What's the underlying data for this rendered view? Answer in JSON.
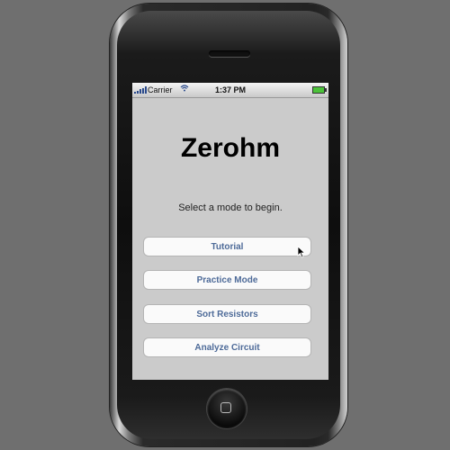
{
  "status_bar": {
    "carrier": "Carrier",
    "time": "1:37 PM",
    "wifi_icon": "wifi-icon",
    "battery_icon": "battery-icon"
  },
  "app": {
    "title": "Zerohm",
    "subtitle": "Select a mode to begin."
  },
  "modes": [
    {
      "label": "Tutorial"
    },
    {
      "label": "Practice Mode"
    },
    {
      "label": "Sort Resistors"
    },
    {
      "label": "Analyze Circuit"
    }
  ],
  "colors": {
    "button_text": "#4d6a98",
    "screen_bg": "#cbcbcb",
    "backdrop": "#6f6f6f"
  }
}
